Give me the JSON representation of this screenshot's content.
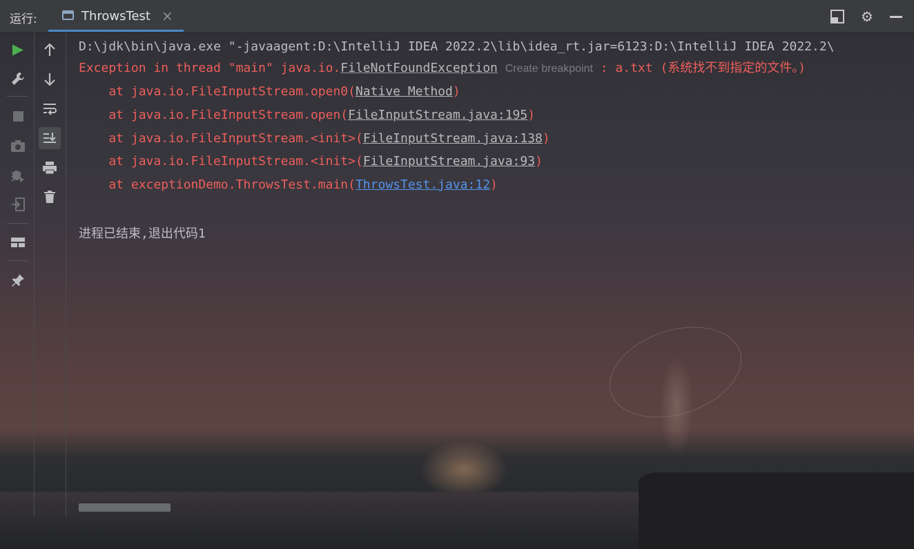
{
  "header": {
    "run_label": "运行:",
    "tab_title": "ThrowsTest",
    "tab_close": "×"
  },
  "toolbar_left": [
    {
      "name": "run-icon"
    },
    {
      "name": "wrench-icon"
    },
    {
      "name": "stop-icon"
    },
    {
      "name": "camera-icon"
    },
    {
      "name": "debug-icon"
    },
    {
      "name": "login-icon"
    },
    {
      "name": "layout-icon"
    },
    {
      "name": "pin-icon"
    }
  ],
  "toolbar_right": [
    {
      "name": "up-arrow-icon"
    },
    {
      "name": "down-arrow-icon"
    },
    {
      "name": "soft-wrap-icon"
    },
    {
      "name": "scroll-to-end-icon"
    },
    {
      "name": "print-icon"
    },
    {
      "name": "trash-icon"
    }
  ],
  "console": {
    "cmd_line": "D:\\jdk\\bin\\java.exe \"-javaagent:D:\\IntelliJ IDEA 2022.2\\lib\\idea_rt.jar=6123:D:\\IntelliJ IDEA 2022.2\\",
    "exc_prefix": "Exception in thread \"main\" java.io.",
    "exc_class": "FileNotFoundException",
    "exc_hint": "Create breakpoint",
    "exc_suffix": " : a.txt (系统找不到指定的文件。)",
    "stack": [
      {
        "prefix": "    at java.io.FileInputStream.open0(",
        "link": "Native Method",
        "suffix": ")"
      },
      {
        "prefix": "    at java.io.FileInputStream.open(",
        "link": "FileInputStream.java:195",
        "suffix": ")"
      },
      {
        "prefix": "    at java.io.FileInputStream.<init>(",
        "link": "FileInputStream.java:138",
        "suffix": ")"
      },
      {
        "prefix": "    at java.io.FileInputStream.<init>(",
        "link": "FileInputStream.java:93",
        "suffix": ")"
      },
      {
        "prefix": "    at exceptionDemo.ThrowsTest.main(",
        "link": "ThrowsTest.java:12",
        "suffix": ")"
      }
    ],
    "exit_message": "进程已结束,退出代码1"
  },
  "colors": {
    "error": "#ee5e5b",
    "link": "#5394ec",
    "accent": "#4a88c7"
  }
}
